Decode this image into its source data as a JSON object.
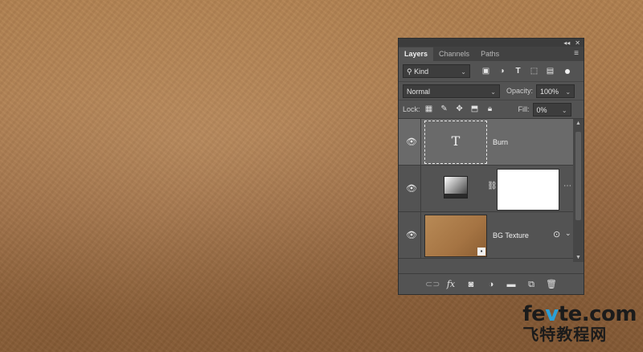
{
  "panel": {
    "tabs": [
      {
        "label": "Layers"
      },
      {
        "label": "Channels"
      },
      {
        "label": "Paths"
      }
    ],
    "filter": {
      "value": "Kind"
    },
    "blend_mode": {
      "value": "Normal"
    },
    "opacity": {
      "label": "Opacity:",
      "value": "100%"
    },
    "lock": {
      "label": "Lock:"
    },
    "fill": {
      "label": "Fill:",
      "value": "0%"
    },
    "layers": [
      {
        "name": "Burn",
        "kind": "text",
        "thumb_glyph": "T",
        "selected": true
      },
      {
        "name": "",
        "kind": "adjustment-with-mask",
        "selected": false
      },
      {
        "name": "BG Texture",
        "kind": "smart-object",
        "selected": false
      }
    ]
  },
  "watermark": {
    "domain_part1": "fe",
    "domain_accent": "v",
    "domain_part2": "te.com",
    "chinese": "飞特教程网"
  },
  "colors": {
    "panel_bg": "#535353",
    "selected_layer": "#6a6a6a",
    "canvas_leather": "#a9784a",
    "watermark_accent": "#2aa0d8"
  }
}
